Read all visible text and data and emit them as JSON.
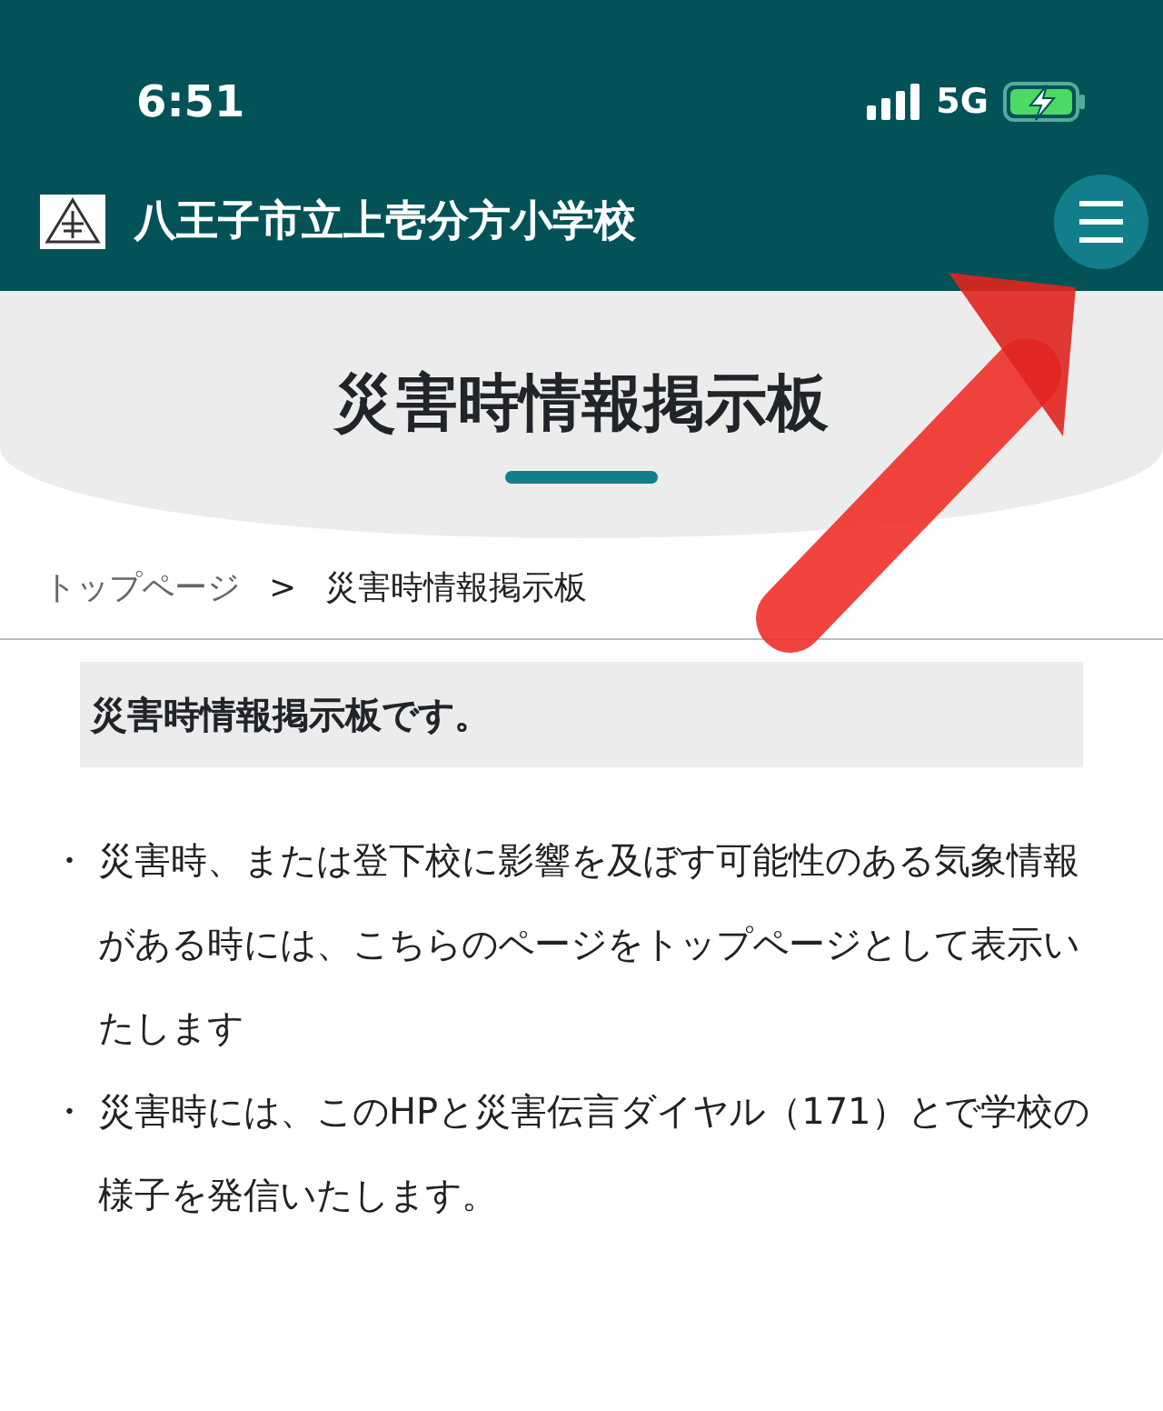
{
  "status_bar": {
    "time": "6:51",
    "network": "5G"
  },
  "header": {
    "site_title": "八王子市立上壱分方小学校"
  },
  "page_title": "災害時情報掲示板",
  "breadcrumb": [
    {
      "label": "トップページ",
      "current": false
    },
    {
      "label": "災害時情報掲示板",
      "current": true
    }
  ],
  "breadcrumb_separator": ">",
  "lead": "災害時情報掲示板です。",
  "bullets": [
    {
      "marker": "・",
      "text": "災害時、または登下校に影響を及ぼす可能性のある気象情報がある時には、こちらのページをトップページとして表示いたします"
    },
    {
      "marker": "・",
      "text": "災害時には、このHPと災害伝言ダイヤル（171）とで学校の様子を発信いたします。"
    }
  ]
}
